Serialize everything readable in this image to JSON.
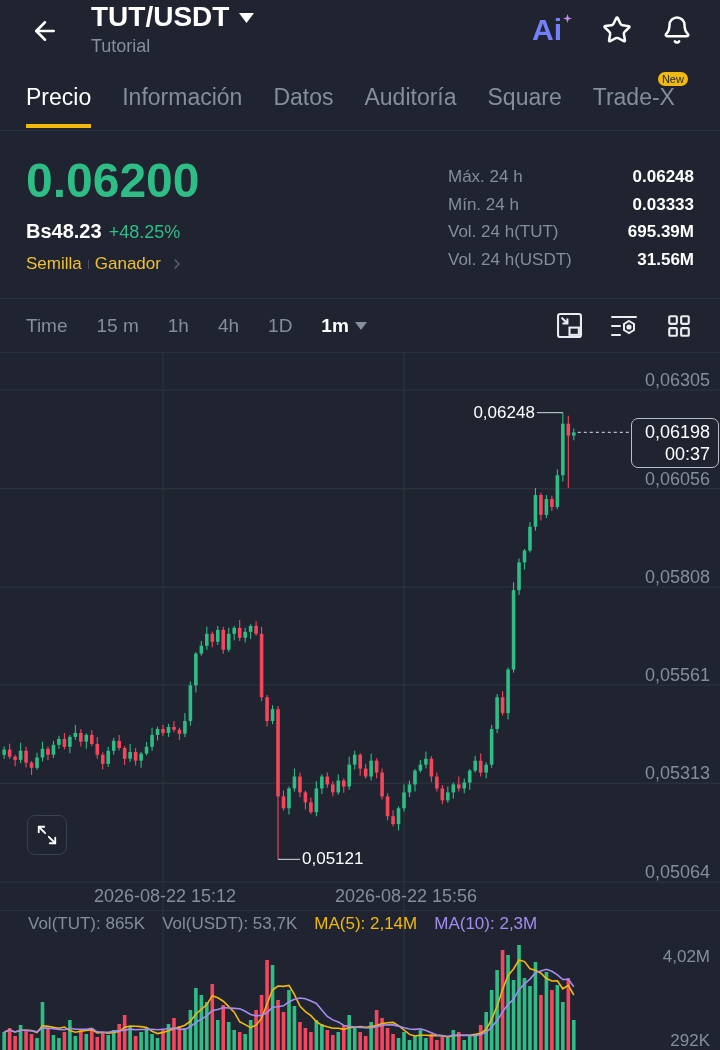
{
  "header": {
    "title": "TUT/USDT",
    "subtitle": "Tutorial",
    "ai_label": "Ai"
  },
  "tabs": [
    {
      "label": "Precio",
      "selected": true
    },
    {
      "label": "Información",
      "selected": false
    },
    {
      "label": "Datos",
      "selected": false
    },
    {
      "label": "Auditoría",
      "selected": false
    },
    {
      "label": "Square",
      "selected": false
    },
    {
      "label": "Trade-X",
      "selected": false,
      "badge": "New"
    }
  ],
  "price": {
    "last": "0.06200",
    "up": true,
    "fiat": "Bs48.23",
    "change": "+48.25%",
    "tags": [
      "Semilla",
      "Ganador"
    ]
  },
  "stats": [
    {
      "label": "Máx. 24 h",
      "value": "0.06248"
    },
    {
      "label": "Mín. 24 h",
      "value": "0.03333"
    },
    {
      "label": "Vol. 24 h(TUT)",
      "value": "695.39M"
    },
    {
      "label": "Vol. 24 h(USDT)",
      "value": "31.56M"
    }
  ],
  "intervals": [
    {
      "label": "Time",
      "selected": false,
      "menu": false
    },
    {
      "label": "15 m",
      "selected": false,
      "menu": false
    },
    {
      "label": "1h",
      "selected": false,
      "menu": false
    },
    {
      "label": "4h",
      "selected": false,
      "menu": false
    },
    {
      "label": "1D",
      "selected": false,
      "menu": false
    },
    {
      "label": "1m",
      "selected": true,
      "menu": true
    }
  ],
  "chart": {
    "chart_data": {
      "type": "candlestick",
      "grid": true,
      "categories": [
        null,
        null,
        null,
        null,
        null,
        null,
        null,
        null,
        null,
        null,
        null,
        null,
        null,
        null,
        null,
        null,
        null,
        null,
        null,
        null,
        null,
        null,
        null,
        null,
        null,
        null,
        null,
        null,
        null,
        "2026-08-22 15:12",
        null,
        null,
        null,
        null,
        null,
        null,
        null,
        null,
        null,
        null,
        null,
        null,
        null,
        null,
        null,
        null,
        null,
        null,
        null,
        null,
        null,
        null,
        null,
        null,
        null,
        null,
        null,
        null,
        null,
        null,
        null,
        null,
        null,
        null,
        null,
        null,
        null,
        null,
        null,
        null,
        null,
        null,
        null,
        "2026-08-22 15:56",
        null,
        null,
        null,
        null,
        null,
        null,
        null,
        null,
        null,
        null,
        null,
        null,
        null,
        null,
        null,
        null,
        null,
        null,
        null,
        null,
        null,
        null,
        null,
        null,
        null,
        null,
        null,
        null,
        null,
        null,
        null
      ],
      "ohlc": [
        [
          0.05385,
          0.05406,
          0.05375,
          0.05398
        ],
        [
          0.05398,
          0.05413,
          0.05374,
          0.0538
        ],
        [
          0.0538,
          0.05385,
          0.05356,
          0.05372
        ],
        [
          0.05372,
          0.05415,
          0.05364,
          0.05395
        ],
        [
          0.05395,
          0.05405,
          0.05353,
          0.05365
        ],
        [
          0.05365,
          0.05369,
          0.05334,
          0.05352
        ],
        [
          0.05352,
          0.0539,
          0.05347,
          0.05378
        ],
        [
          0.05378,
          0.05418,
          0.05368,
          0.054
        ],
        [
          0.054,
          0.05406,
          0.05371,
          0.05385
        ],
        [
          0.05385,
          0.0542,
          0.05377,
          0.0541
        ],
        [
          0.0541,
          0.05433,
          0.054,
          0.05425
        ],
        [
          0.05425,
          0.0544,
          0.05399,
          0.05405
        ],
        [
          0.05405,
          0.05435,
          0.05389,
          0.0543
        ],
        [
          0.0543,
          0.0546,
          0.05422,
          0.0544
        ],
        [
          0.0544,
          0.0545,
          0.05406,
          0.05418
        ],
        [
          0.05418,
          0.05439,
          0.054,
          0.05435
        ],
        [
          0.05435,
          0.05447,
          0.05407,
          0.05412
        ],
        [
          0.05412,
          0.0543,
          0.05375,
          0.05385
        ],
        [
          0.05385,
          0.05391,
          0.05348,
          0.05362
        ],
        [
          0.05362,
          0.05405,
          0.05354,
          0.05395
        ],
        [
          0.05395,
          0.05428,
          0.05385,
          0.0542
        ],
        [
          0.0542,
          0.05435,
          0.05396,
          0.05402
        ],
        [
          0.05402,
          0.05407,
          0.05359,
          0.05375
        ],
        [
          0.05375,
          0.05412,
          0.05367,
          0.05392
        ],
        [
          0.05392,
          0.05402,
          0.05358,
          0.0537
        ],
        [
          0.0537,
          0.05392,
          0.05352,
          0.05388
        ],
        [
          0.05388,
          0.05417,
          0.05383,
          0.05405
        ],
        [
          0.05405,
          0.05453,
          0.05395,
          0.05435
        ],
        [
          0.05435,
          0.05456,
          0.05421,
          0.0545
        ],
        [
          0.0545,
          0.0546,
          0.05432,
          0.0544
        ],
        [
          0.0544,
          0.05463,
          0.0543,
          0.05455
        ],
        [
          0.05455,
          0.0547,
          0.05442,
          0.05448
        ],
        [
          0.05448,
          0.05453,
          0.05422,
          0.05438
        ],
        [
          0.05438,
          0.0549,
          0.0543,
          0.0547
        ],
        [
          0.0547,
          0.0557,
          0.05458,
          0.0556
        ],
        [
          0.0556,
          0.05644,
          0.05542,
          0.0564
        ],
        [
          0.0564,
          0.05672,
          0.05635,
          0.0566
        ],
        [
          0.0566,
          0.05708,
          0.0565,
          0.0569
        ],
        [
          0.0569,
          0.05696,
          0.05656,
          0.0567
        ],
        [
          0.0567,
          0.0571,
          0.05662,
          0.057
        ],
        [
          0.057,
          0.05708,
          0.0564,
          0.0565
        ],
        [
          0.0565,
          0.05705,
          0.05644,
          0.0569
        ],
        [
          0.0569,
          0.0571,
          0.05674,
          0.05705
        ],
        [
          0.05705,
          0.05725,
          0.05672,
          0.0568
        ],
        [
          0.0568,
          0.05705,
          0.05668,
          0.05695
        ],
        [
          0.05695,
          0.05714,
          0.05677,
          0.0571
        ],
        [
          0.0571,
          0.05722,
          0.05685,
          0.0569
        ],
        [
          0.0569,
          0.05708,
          0.0552,
          0.0553
        ],
        [
          0.0553,
          0.05536,
          0.05456,
          0.0547
        ],
        [
          0.0547,
          0.0551,
          0.05462,
          0.055
        ],
        [
          0.055,
          0.05508,
          0.05121,
          0.0528
        ],
        [
          0.0528,
          0.05295,
          0.05244,
          0.0525
        ],
        [
          0.0525,
          0.05305,
          0.05234,
          0.053
        ],
        [
          0.053,
          0.0535,
          0.05292,
          0.0533
        ],
        [
          0.0533,
          0.0534,
          0.05278,
          0.0529
        ],
        [
          0.0529,
          0.05294,
          0.05247,
          0.05265
        ],
        [
          0.05265,
          0.05277,
          0.05235,
          0.0524
        ],
        [
          0.0524,
          0.05318,
          0.0523,
          0.053
        ],
        [
          0.053,
          0.05336,
          0.05286,
          0.0533
        ],
        [
          0.0533,
          0.0534,
          0.05302,
          0.0531
        ],
        [
          0.0531,
          0.05318,
          0.0528,
          0.0529
        ],
        [
          0.0529,
          0.05335,
          0.05284,
          0.0532
        ],
        [
          0.0532,
          0.05325,
          0.05289,
          0.05305
        ],
        [
          0.05305,
          0.0538,
          0.05297,
          0.0536
        ],
        [
          0.0536,
          0.05395,
          0.05348,
          0.05385
        ],
        [
          0.05385,
          0.05389,
          0.05332,
          0.0535
        ],
        [
          0.0535,
          0.05362,
          0.05325,
          0.0533
        ],
        [
          0.0533,
          0.05388,
          0.0532,
          0.0537
        ],
        [
          0.0537,
          0.05376,
          0.05326,
          0.0534
        ],
        [
          0.0534,
          0.0535,
          0.05272,
          0.0528
        ],
        [
          0.0528,
          0.05288,
          0.0522,
          0.0523
        ],
        [
          0.0523,
          0.05245,
          0.05204,
          0.0521
        ],
        [
          0.0521,
          0.05255,
          0.05194,
          0.0525
        ],
        [
          0.0525,
          0.0531,
          0.05242,
          0.0529
        ],
        [
          0.0529,
          0.0532,
          0.05278,
          0.0531
        ],
        [
          0.0531,
          0.05349,
          0.05292,
          0.05345
        ],
        [
          0.05345,
          0.05372,
          0.0534,
          0.0536
        ],
        [
          0.0536,
          0.05393,
          0.0535,
          0.05375
        ],
        [
          0.05375,
          0.05381,
          0.05316,
          0.0533
        ],
        [
          0.0533,
          0.0534,
          0.05292,
          0.053
        ],
        [
          0.053,
          0.05308,
          0.0526,
          0.0527
        ],
        [
          0.0527,
          0.05305,
          0.05264,
          0.0529
        ],
        [
          0.0529,
          0.05315,
          0.05274,
          0.0531
        ],
        [
          0.0531,
          0.0533,
          0.05292,
          0.053
        ],
        [
          0.053,
          0.05325,
          0.05288,
          0.05315
        ],
        [
          0.05315,
          0.05349,
          0.05297,
          0.05345
        ],
        [
          0.05345,
          0.05382,
          0.0534,
          0.0537
        ],
        [
          0.0537,
          0.05388,
          0.0533,
          0.0534
        ],
        [
          0.0534,
          0.05366,
          0.05326,
          0.0536
        ],
        [
          0.0536,
          0.0546,
          0.05352,
          0.0545
        ],
        [
          0.0545,
          0.05538,
          0.0544,
          0.0553
        ],
        [
          0.0553,
          0.05545,
          0.05484,
          0.0549
        ],
        [
          0.0549,
          0.05605,
          0.05474,
          0.056
        ],
        [
          0.056,
          0.0582,
          0.05592,
          0.058
        ],
        [
          0.058,
          0.0588,
          0.05788,
          0.0587
        ],
        [
          0.0587,
          0.05904,
          0.05852,
          0.059
        ],
        [
          0.059,
          0.05972,
          0.05895,
          0.0596
        ],
        [
          0.0596,
          0.06058,
          0.0595,
          0.0604
        ],
        [
          0.0604,
          0.06046,
          0.05976,
          0.0599
        ],
        [
          0.0599,
          0.0604,
          0.05982,
          0.0603
        ],
        [
          0.0603,
          0.06038,
          0.06,
          0.0601
        ],
        [
          0.0601,
          0.06105,
          0.06004,
          0.0609
        ],
        [
          0.0609,
          0.06248,
          0.06074,
          0.0622
        ],
        [
          0.0622,
          0.0624,
          0.06058,
          0.0619
        ],
        [
          0.0619,
          0.06208,
          0.06178,
          0.06198
        ]
      ],
      "ylim": [
        0.049934,
        0.063983
      ],
      "yticks": [
        {
          "value": 0.06305,
          "label": "0,06305"
        },
        {
          "value": 0.06056,
          "label": "0,06056"
        },
        {
          "value": 0.05808,
          "label": "0,05808"
        },
        {
          "value": 0.05561,
          "label": "0,05561"
        },
        {
          "value": 0.05313,
          "label": "0,05313"
        },
        {
          "value": 0.05064,
          "label": "0,05064"
        }
      ]
    },
    "high_label": "0,06248",
    "low_label": "0,05121",
    "last_price": "0,06198",
    "countdown": "00:37"
  },
  "volume": {
    "legend": [
      {
        "label": "Vol(TUT): 865K",
        "color": "#848e9c"
      },
      {
        "label": "Vol(USDT): 53,7K",
        "color": "#848e9c"
      },
      {
        "label": "MA(5): 2,14M",
        "color": "#f0b90b"
      },
      {
        "label": "MA(10): 2,3M",
        "color": "#a48cf0"
      }
    ],
    "axis": [
      "4,02M",
      "292K"
    ]
  }
}
